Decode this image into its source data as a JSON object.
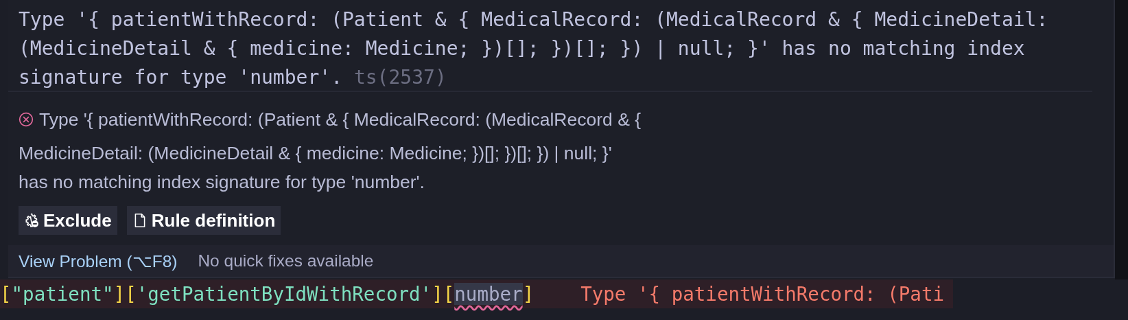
{
  "hover": {
    "message": "Type '{ patientWithRecord: (Patient & { MedicalRecord: (MedicalRecord & { MedicineDetail: (MedicineDetail & { medicine: Medicine; })[]; })[]; }) | null; }' has no matching index signature for type 'number'.",
    "code": "ts(2537)",
    "problem": {
      "error": true,
      "lines": [
        "Type '{ patientWithRecord: (Patient & { MedicalRecord: (MedicalRecord & {",
        "MedicineDetail: (MedicineDetail & { medicine: Medicine; })[]; })[]; }) | null; }'",
        "has no matching index signature for type 'number'."
      ]
    },
    "actions": [
      {
        "label": "Exclude",
        "kind": "exclude"
      },
      {
        "label": "Rule definition",
        "kind": "rule"
      }
    ],
    "status_bar": {
      "link": "View Problem (⌥F8)",
      "note": "No quick fixes available"
    }
  },
  "code_line": {
    "tokens": [
      {
        "text": "[",
        "kind": "bracket"
      },
      {
        "text": "\"patient\"",
        "kind": "string"
      },
      {
        "text": "]",
        "kind": "bracket"
      },
      {
        "text": "[",
        "kind": "bracket"
      },
      {
        "text": "'getPatientByIdWithRecord'",
        "kind": "string"
      },
      {
        "text": "]",
        "kind": "bracket"
      },
      {
        "text": "[",
        "kind": "bracket"
      },
      {
        "text": "number",
        "kind": "error"
      },
      {
        "text": "]",
        "kind": "bracket"
      }
    ],
    "inline_error": "Type '{ patientWithRecord: (Pati"
  }
}
